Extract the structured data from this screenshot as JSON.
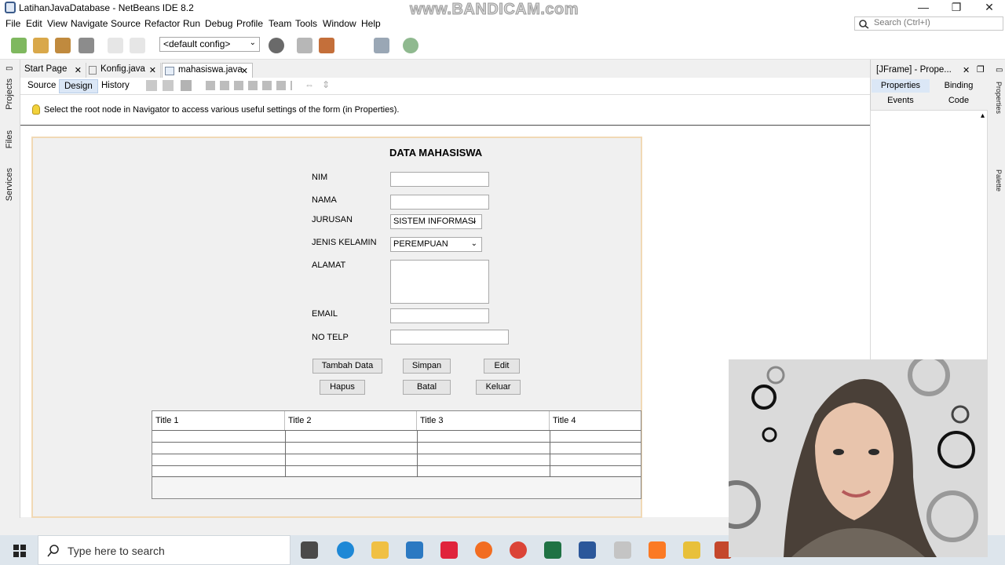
{
  "window": {
    "title": "LatihanJavaDatabase - NetBeans IDE 8.2",
    "watermark": "www.BANDICAM.com",
    "controls": {
      "minimize": "—",
      "maximize": "❐",
      "close": "✕"
    }
  },
  "menu": {
    "items": [
      "File",
      "Edit",
      "View",
      "Navigate",
      "Source",
      "Refactor",
      "Run",
      "Debug",
      "Profile",
      "Team",
      "Tools",
      "Window",
      "Help"
    ],
    "search_placeholder": "Search (Ctrl+I)"
  },
  "toolbar": {
    "config": "<default config>"
  },
  "side_tabs": [
    "Projects",
    "Files",
    "Services"
  ],
  "right_side_tabs": [
    "Properties",
    "Palette"
  ],
  "editor_tabs": [
    {
      "label": "Start Page",
      "close": "✕"
    },
    {
      "label": "Konfig.java",
      "close": "✕"
    },
    {
      "label": "mahasiswa.java",
      "close": "✕"
    }
  ],
  "editor_modes": [
    "Source",
    "Design",
    "History"
  ],
  "hint": "Select the root node in Navigator to access various useful settings of the form (in Properties).",
  "form": {
    "title": "DATA MAHASISWA",
    "labels": {
      "nim": "NIM",
      "nama": "NAMA",
      "jurusan": "JURUSAN",
      "jenis_kelamin": "JENIS KELAMIN",
      "alamat": "ALAMAT",
      "email": "EMAIL",
      "no_telp": "NO TELP"
    },
    "jurusan_value": "SISTEM INFORMASI",
    "jenis_kelamin_value": "PEREMPUAN",
    "buttons": {
      "tambah_data": "Tambah Data",
      "simpan": "Simpan",
      "edit": "Edit",
      "hapus": "Hapus",
      "batal": "Batal",
      "keluar": "Keluar"
    },
    "table": {
      "columns": [
        "Title 1",
        "Title 2",
        "Title 3",
        "Title 4"
      ],
      "rows": [
        [
          "",
          "",
          "",
          ""
        ],
        [
          "",
          "",
          "",
          ""
        ],
        [
          "",
          "",
          "",
          ""
        ],
        [
          "",
          "",
          "",
          ""
        ]
      ]
    }
  },
  "properties_panel": {
    "title": "[JFrame] - Prope...",
    "close": "✕",
    "tabs": [
      "Properties",
      "Binding",
      "Events",
      "Code"
    ]
  },
  "taskbar": {
    "search_placeholder": "Type here to search"
  }
}
